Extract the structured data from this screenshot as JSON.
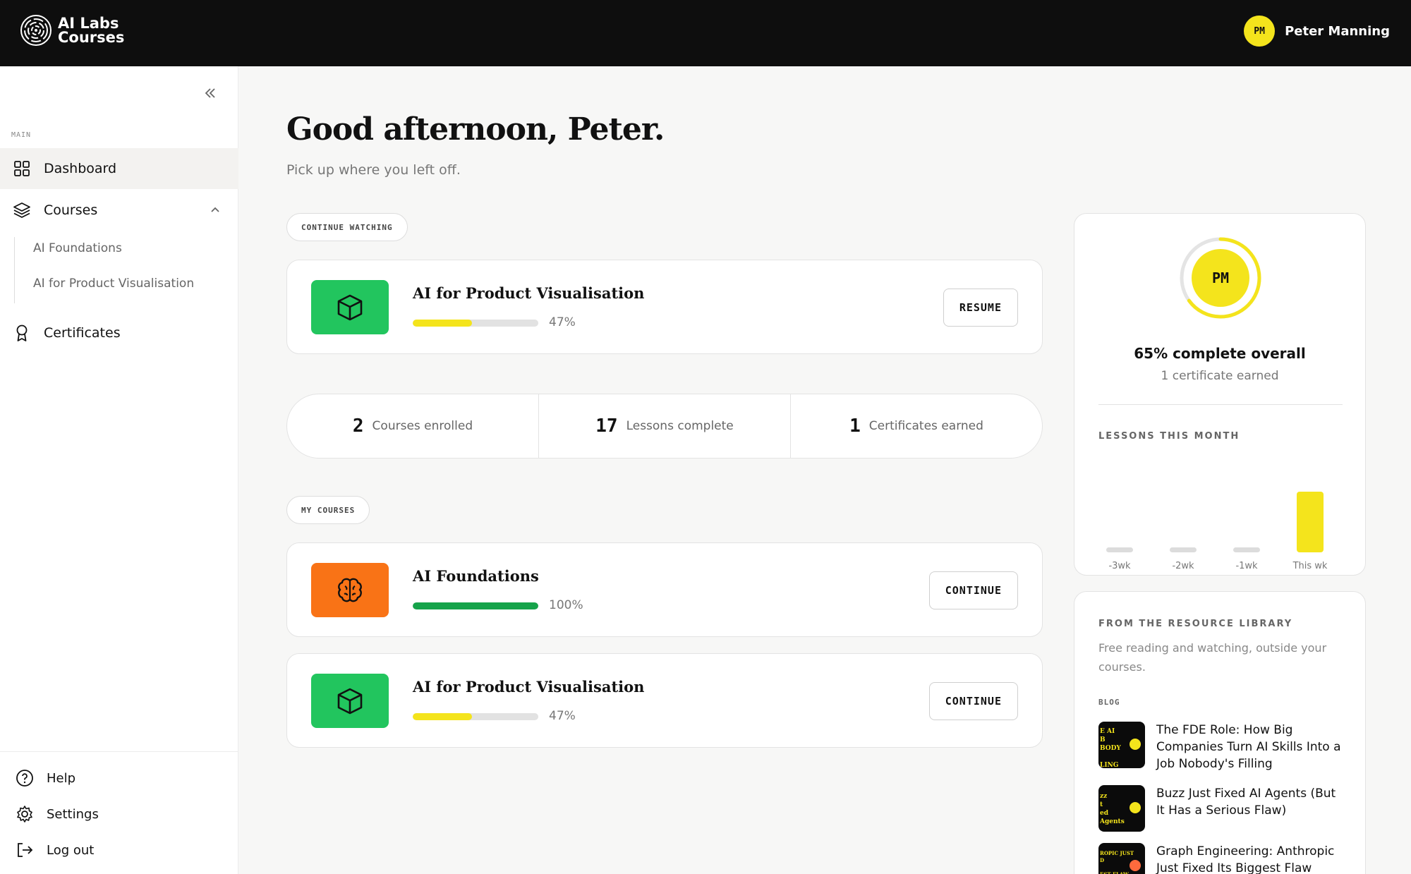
{
  "app": {
    "logo_line1": "AI Labs",
    "logo_line2": "Courses"
  },
  "user": {
    "initials": "PM",
    "name": "Peter Manning"
  },
  "sidebar": {
    "section_label": "MAIN",
    "dashboard": "Dashboard",
    "courses": "Courses",
    "sub_items": [
      "AI Foundations",
      "AI for Product Visualisation"
    ],
    "certificates": "Certificates",
    "help": "Help",
    "settings": "Settings",
    "logout": "Log out"
  },
  "main": {
    "greeting": "Good afternoon, Peter.",
    "subtitle": "Pick up where you left off.",
    "continue_label": "CONTINUE WATCHING",
    "continue_course": {
      "title": "AI for Product Visualisation",
      "progress": 47,
      "progress_text": "47%",
      "button": "RESUME",
      "thumb_color": "#22c55e",
      "bar_color": "#f4e41c",
      "icon": "cube-icon"
    },
    "stats": [
      {
        "num": "2",
        "label": "Courses enrolled"
      },
      {
        "num": "17",
        "label": "Lessons complete"
      },
      {
        "num": "1",
        "label": "Certificates earned"
      }
    ],
    "my_courses_label": "MY COURSES",
    "courses": [
      {
        "title": "AI Foundations",
        "progress": 100,
        "progress_text": "100%",
        "button": "CONTINUE",
        "thumb_color": "#f97316",
        "bar_color": "#16a34a",
        "icon": "brain-icon"
      },
      {
        "title": "AI for Product Visualisation",
        "progress": 47,
        "progress_text": "47%",
        "button": "CONTINUE",
        "thumb_color": "#22c55e",
        "bar_color": "#f4e41c",
        "icon": "cube-icon"
      }
    ]
  },
  "progress_panel": {
    "initials": "PM",
    "overall_progress": 65,
    "overall_text": "65% complete overall",
    "cert_text": "1 certificate earned",
    "chart_label": "LESSONS THIS MONTH",
    "ring_color": "#f4e41c"
  },
  "chart_data": {
    "type": "bar",
    "categories": [
      "-3wk",
      "-2wk",
      "-1wk",
      "This wk"
    ],
    "values": [
      0,
      0,
      0,
      17
    ],
    "title": "LESSONS THIS MONTH",
    "highlight_color": "#f4e41c",
    "empty_color": "#dcdcdc"
  },
  "library": {
    "label": "FROM THE RESOURCE LIBRARY",
    "description": "Free reading and watching, outside your courses.",
    "blog_label": "BLOG",
    "posts": [
      {
        "title": "The FDE Role: How Big Companies Turn AI Skills Into a Job Nobody's Filling",
        "thumb_text": "E AI\nB\nBODY\n\nLING"
      },
      {
        "title": "Buzz Just Fixed AI Agents (But It Has a Serious Flaw)",
        "thumb_text": "zz\nt\ned\nAgents"
      },
      {
        "title": "Graph Engineering: Anthropic Just Fixed Its Biggest Flaw",
        "thumb_text": "ROPIC JUST\nD\n\nEST FLAW"
      }
    ]
  }
}
